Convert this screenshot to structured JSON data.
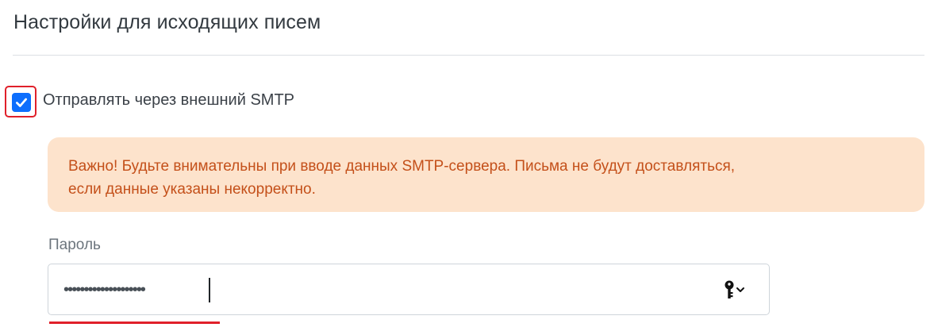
{
  "section": {
    "title": "Настройки для исходящих писем"
  },
  "smtp": {
    "checkbox_label": "Отправлять через внешний SMTP",
    "checked": true
  },
  "alert": {
    "line1": "Важно! Будьте внимательны при вводе данных SMTP-сервера. Письма не будут доставляться,",
    "line2": "если данные указаны некорректно."
  },
  "password": {
    "label": "Пароль",
    "masked_value": "••••••••••••••••••••",
    "key_icon": "key-icon"
  },
  "colors": {
    "accent": "#0d6efd",
    "highlight": "#e0202a",
    "alert_bg": "#fde3cc",
    "alert_text": "#c4501a"
  }
}
